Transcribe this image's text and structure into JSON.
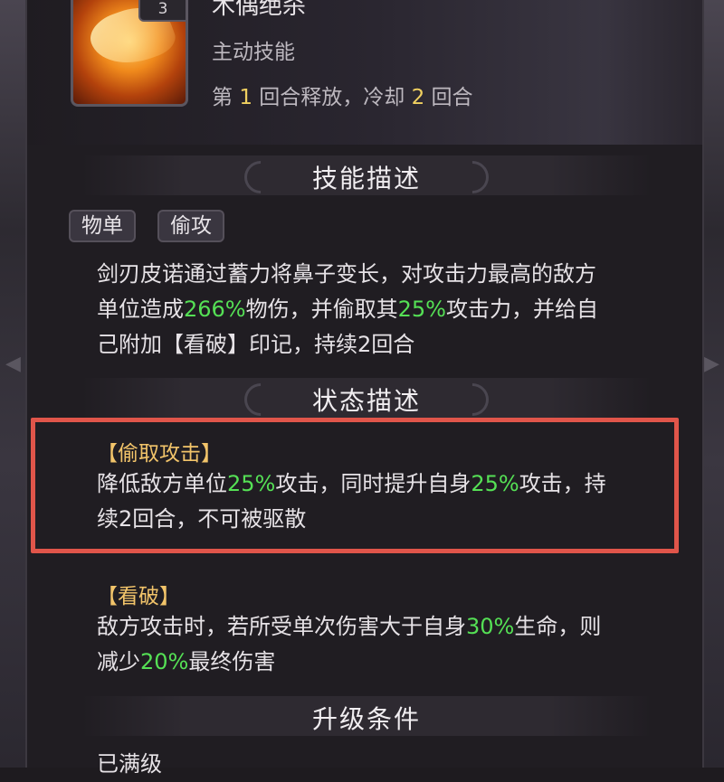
{
  "skill": {
    "cost": "3",
    "name": "木偶绝杀",
    "type": "主动技能",
    "timing_prefix": "第",
    "timing_round": "1",
    "timing_mid": "回合释放，冷却",
    "timing_cooldown": "2",
    "timing_suffix": "回合"
  },
  "sections": {
    "skill_desc": "技能描述",
    "status_desc": "状态描述",
    "upgrade": "升级条件"
  },
  "tags": [
    "物单",
    "偷攻"
  ],
  "description": {
    "line1": "剑刃皮诺通过蓄力将鼻子变长，对攻击力最高的敌方",
    "line2_a": "单位造成",
    "line2_b": "266%",
    "line2_c": "物伤，并偷取其",
    "line2_d": "25%",
    "line2_e": "攻击力，并给自",
    "line3": "己附加【看破】印记，持续2回合"
  },
  "status1": {
    "head": "【偷取攻击】",
    "l1_a": "降低敌方单位",
    "l1_b": "25%",
    "l1_c": "攻击，同时提升自身",
    "l1_d": "25%",
    "l1_e": "攻击，持",
    "l2": "续2回合，不可被驱散"
  },
  "status2": {
    "head": "【看破】",
    "l1_a": "敌方攻击时，若所受单次伤害大于自身",
    "l1_b": "30%",
    "l1_c": "生命，则",
    "l2_a": "减少",
    "l2_b": "20%",
    "l2_c": "最终伤害"
  },
  "upgrade_text": "已满级",
  "colors": {
    "highlight": "#55e055",
    "accent": "#f0d060",
    "status_head": "#f2c46a",
    "box": "#e0554a"
  }
}
